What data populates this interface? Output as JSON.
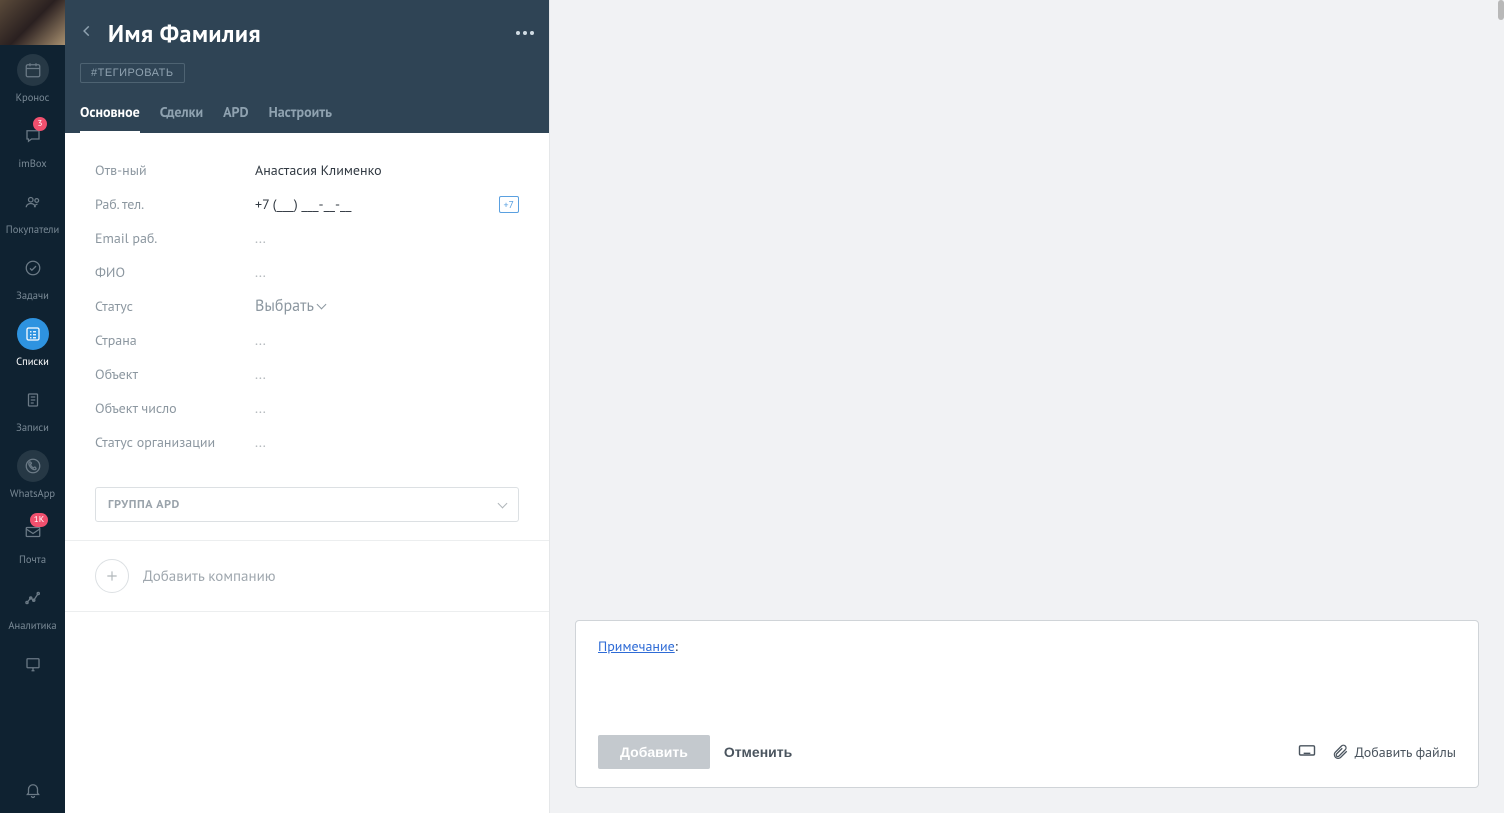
{
  "sidebar": {
    "items": [
      {
        "id": "kronos",
        "label": "Кронос",
        "icon": "calendar-icon",
        "badge": null,
        "state": "hl"
      },
      {
        "id": "imbox",
        "label": "imBox",
        "icon": "chat-icon",
        "badge": "3",
        "state": ""
      },
      {
        "id": "buyers",
        "label": "Покупатели",
        "icon": "people-icon",
        "badge": null,
        "state": ""
      },
      {
        "id": "tasks",
        "label": "Задачи",
        "icon": "check-icon",
        "badge": null,
        "state": ""
      },
      {
        "id": "lists",
        "label": "Списки",
        "icon": "lists-icon",
        "badge": null,
        "state": "active"
      },
      {
        "id": "records",
        "label": "Записи",
        "icon": "receipt-icon",
        "badge": null,
        "state": ""
      },
      {
        "id": "whatsapp",
        "label": "WhatsApp",
        "icon": "whatsapp-icon",
        "badge": null,
        "state": "hl"
      },
      {
        "id": "mail",
        "label": "Почта",
        "icon": "mail-icon",
        "badge": "1K",
        "state": ""
      },
      {
        "id": "analytics",
        "label": "Аналитика",
        "icon": "analytics-icon",
        "badge": null,
        "state": ""
      },
      {
        "id": "terminal",
        "label": "",
        "icon": "terminal-icon",
        "badge": null,
        "state": ""
      }
    ],
    "bell_label": ""
  },
  "header": {
    "title": "Имя Фамилия",
    "tag_button": "#ТЕГИРОВАТЬ",
    "tabs": [
      "Основное",
      "Сделки",
      "APD",
      "Настроить"
    ],
    "active_tab": 0
  },
  "fields": {
    "responsible": {
      "label": "Отв-ный",
      "value": "Анастасия Клименко"
    },
    "work_phone": {
      "label": "Раб. тел.",
      "value": "+7 (___) ___-__-__",
      "badge": "+7"
    },
    "work_email": {
      "label": "Email раб.",
      "value": "..."
    },
    "fio": {
      "label": "ФИО",
      "value": "..."
    },
    "status": {
      "label": "Статус",
      "value": "Выбрать"
    },
    "country": {
      "label": "Страна",
      "value": "..."
    },
    "object": {
      "label": "Объект",
      "value": "..."
    },
    "object_num": {
      "label": "Объект число",
      "value": "..."
    },
    "org_status": {
      "label": "Статус организации",
      "value": "..."
    }
  },
  "group_select": {
    "label": "ГРУППА APD"
  },
  "add_company": {
    "label": "Добавить компанию"
  },
  "note": {
    "title": "Примечание",
    "colon": ":",
    "add_btn": "Добавить",
    "cancel_btn": "Отменить",
    "attach_label": "Добавить файлы"
  }
}
